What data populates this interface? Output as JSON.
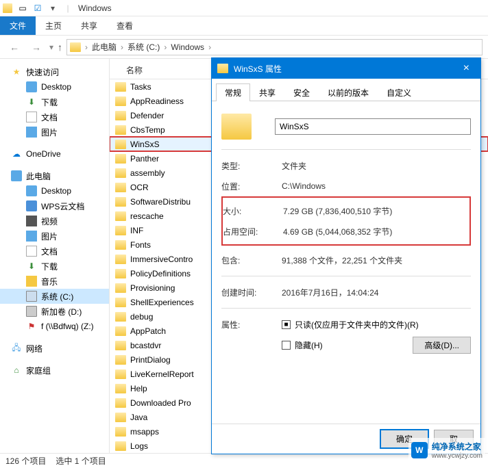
{
  "titlebar": {
    "title": "Windows"
  },
  "ribbon": {
    "file": "文件",
    "tabs": [
      "主页",
      "共享",
      "查看"
    ]
  },
  "breadcrumb": [
    "此电脑",
    "系统 (C:)",
    "Windows"
  ],
  "sidebar": {
    "quick": "快速访问",
    "desktop": "Desktop",
    "downloads": "下载",
    "documents": "文档",
    "pictures": "图片",
    "onedrive": "OneDrive",
    "thispc": "此电脑",
    "pc_desktop": "Desktop",
    "pc_wps": "WPS云文档",
    "pc_video": "视频",
    "pc_pic": "图片",
    "pc_doc": "文档",
    "pc_dl": "下载",
    "pc_music": "音乐",
    "pc_cdrive": "系统 (C:)",
    "pc_ddrive": "新加卷 (D:)",
    "pc_zdrive": "f (\\\\Bdfwq) (Z:)",
    "network": "网络",
    "homegroup": "家庭组"
  },
  "filelist": {
    "col_name": "名称",
    "items": [
      "Tasks",
      "AppReadiness",
      "Defender",
      "CbsTemp",
      "WinSxS",
      "Panther",
      "assembly",
      "OCR",
      "SoftwareDistribu",
      "rescache",
      "INF",
      "Fonts",
      "ImmersiveContro",
      "PolicyDefinitions",
      "Provisioning",
      "ShellExperiences",
      "debug",
      "AppPatch",
      "bcastdvr",
      "PrintDialog",
      "LiveKernelReport",
      "Help",
      "Downloaded Pro",
      "Java",
      "msapps",
      "Logs"
    ]
  },
  "statusbar": {
    "count": "126 个项目",
    "selected": "选中 1 个项目"
  },
  "dialog": {
    "title": "WinSxS 属性",
    "tabs": [
      "常规",
      "共享",
      "安全",
      "以前的版本",
      "自定义"
    ],
    "name": "WinSxS",
    "rows": {
      "type_l": "类型:",
      "type_v": "文件夹",
      "loc_l": "位置:",
      "loc_v": "C:\\Windows",
      "size_l": "大小:",
      "size_v": "7.29 GB (7,836,400,510 字节)",
      "disk_l": "占用空间:",
      "disk_v": "4.69 GB (5,044,068,352 字节)",
      "contain_l": "包含:",
      "contain_v": "91,388 个文件，22,251 个文件夹",
      "created_l": "创建时间:",
      "created_v": "2016年7月16日，14:04:24",
      "attr_l": "属性:",
      "readonly": "只读(仅应用于文件夹中的文件)(R)",
      "hidden": "隐藏(H)",
      "advanced": "高级(D)..."
    },
    "buttons": {
      "ok": "确定",
      "cancel": "取"
    }
  },
  "watermark": {
    "name": "纯净系统之家",
    "url": "www.ycwjzy.com"
  }
}
